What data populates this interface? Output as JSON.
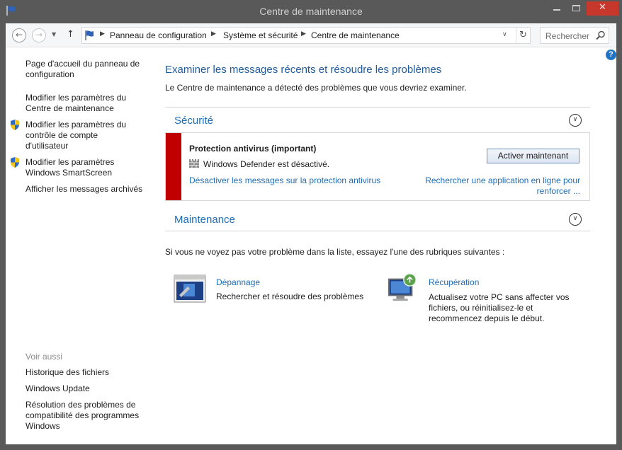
{
  "window": {
    "title": "Centre de maintenance",
    "minimize_glyph": "",
    "maximize_glyph": "",
    "close_glyph": "✕"
  },
  "nav": {
    "back_glyph": "←",
    "forward_glyph": "→",
    "recent_glyph": "▼",
    "up_glyph": "↑",
    "breadcrumb": [
      "Panneau de configuration",
      "Système et sécurité",
      "Centre de maintenance"
    ],
    "breadcrumb_sep": "▶",
    "dropdown_glyph": "∨",
    "refresh_glyph": "↻",
    "search_placeholder": "Rechercher"
  },
  "help_glyph": "?",
  "sidebar": {
    "links": [
      {
        "label_lines": [
          "Page d'accueil du panneau de",
          "configuration"
        ],
        "shield": false
      },
      {
        "label_lines": [
          "Modifier les paramètres du",
          "Centre de maintenance"
        ],
        "shield": false
      },
      {
        "label_lines": [
          "Modifier les paramètres du",
          "contrôle de compte",
          "d'utilisateur"
        ],
        "shield": true
      },
      {
        "label_lines": [
          "Modifier les paramètres",
          "Windows SmartScreen"
        ],
        "shield": true
      },
      {
        "label_lines": [
          "Afficher les messages archivés"
        ],
        "shield": false
      }
    ],
    "see_also_heading": "Voir aussi",
    "see_also": [
      {
        "label_lines": [
          "Historique des fichiers"
        ]
      },
      {
        "label_lines": [
          "Windows Update"
        ]
      },
      {
        "label_lines": [
          "Résolution des problèmes de",
          "compatibilité des programmes",
          "Windows"
        ]
      }
    ]
  },
  "main": {
    "heading": "Examiner les messages récents et résoudre les problèmes",
    "subheading": "Le Centre de maintenance a détecté des problèmes que vous devriez examiner.",
    "security": {
      "title": "Sécurité",
      "chevron": "∨",
      "alert": {
        "severity_color": "#c00000",
        "title": "Protection antivirus  (important)",
        "status": "Windows Defender est désactivé.",
        "disable_link": "Désactiver les messages sur la protection antivirus",
        "action_button": "Activer maintenant",
        "online_link_lines": [
          "Rechercher une application en ligne pour",
          "renforcer ..."
        ]
      }
    },
    "maintenance": {
      "title": "Maintenance",
      "chevron": "∨"
    },
    "hint": "Si vous ne voyez pas votre problème dans la liste, essayez l'une des rubriques suivantes :",
    "tools": [
      {
        "title": "Dépannage",
        "desc_lines": [
          "Rechercher et résoudre des problèmes"
        ],
        "icon": "troubleshoot-icon"
      },
      {
        "title": "Récupération",
        "desc_lines": [
          "Actualisez votre PC sans affecter vos",
          "fichiers, ou réinitialisez-le et",
          "recommencez depuis le début."
        ],
        "icon": "recovery-icon"
      }
    ]
  },
  "colors": {
    "link": "#1f6db5",
    "heading": "#1f5c9c",
    "alert_red": "#c00000",
    "close_button": "#c7372b"
  }
}
